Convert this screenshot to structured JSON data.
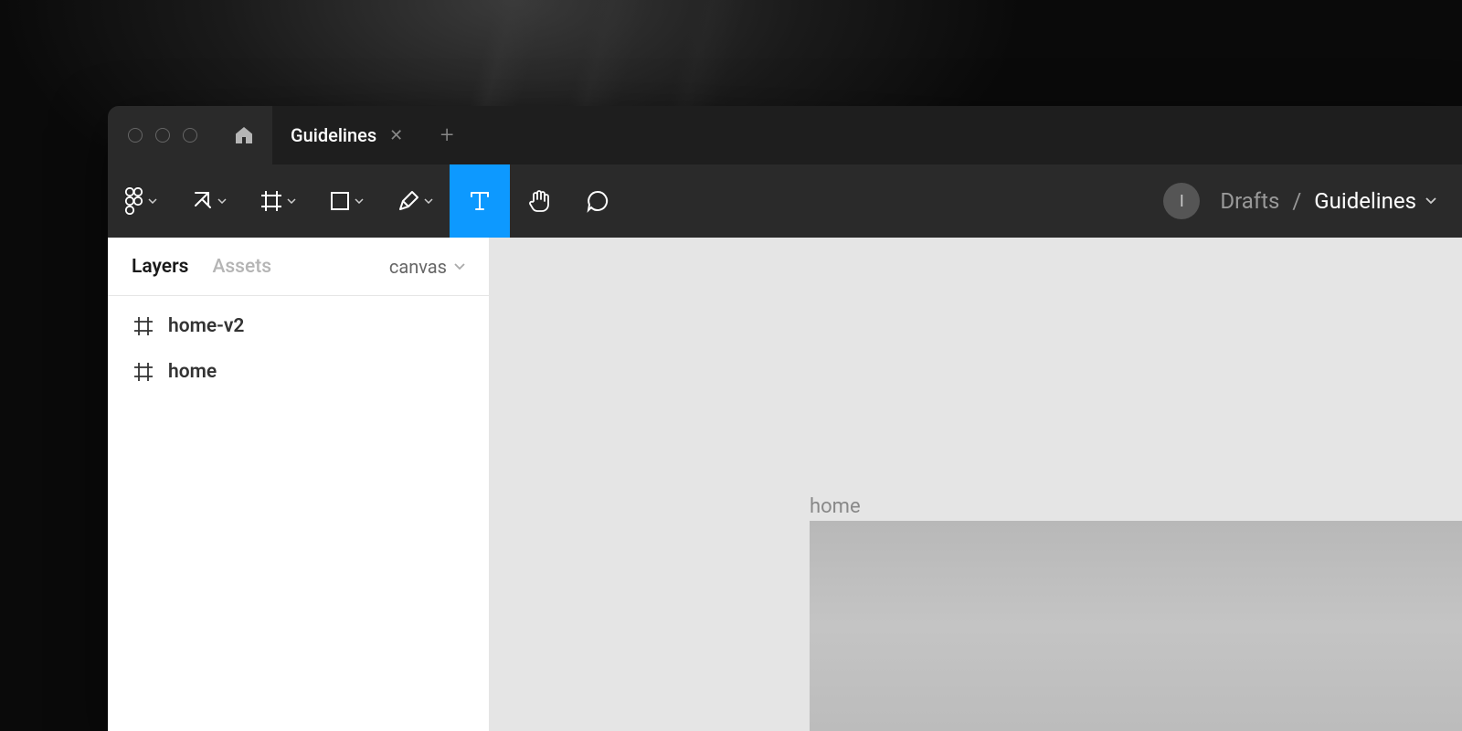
{
  "tab": {
    "title": "Guidelines"
  },
  "breadcrumb": {
    "parent": "Drafts",
    "current": "Guidelines",
    "separator": "/"
  },
  "avatar": {
    "initial": "I"
  },
  "sidebar": {
    "tabs": [
      {
        "label": "Layers",
        "active": true
      },
      {
        "label": "Assets",
        "active": false
      }
    ],
    "page": "canvas",
    "layers": [
      {
        "name": "home-v2"
      },
      {
        "name": "home"
      }
    ]
  },
  "canvas": {
    "frame_label": "home"
  },
  "tools": {
    "menu": "figma-menu",
    "move": "move-tool",
    "frame": "frame-tool",
    "shape": "rectangle-tool",
    "pen": "pen-tool",
    "text": "text-tool",
    "hand": "hand-tool",
    "comment": "comment-tool",
    "active": "text"
  },
  "colors": {
    "accent": "#0d99ff"
  }
}
